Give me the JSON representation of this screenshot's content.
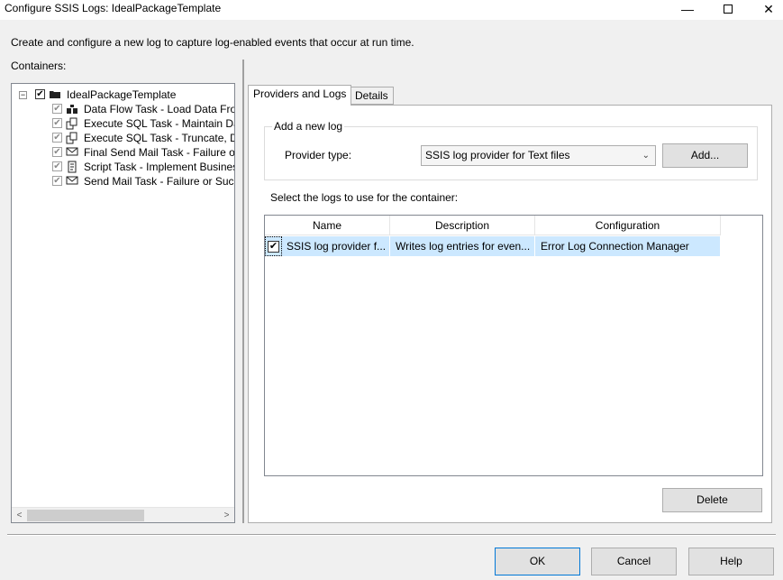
{
  "window": {
    "title": "Configure SSIS Logs: IdealPackageTemplate",
    "minimize_glyph": "—",
    "close_glyph": "✕"
  },
  "intro_text": "Create and configure a new log to capture log-enabled events that occur at run time.",
  "containers": {
    "label": "Containers:",
    "root": {
      "label": "IdealPackageTemplate",
      "expander": "−",
      "checked": "✔",
      "icon": "package-icon"
    },
    "children": [
      {
        "label": "Data Flow Task - Load Data From",
        "icon": "data-flow-icon",
        "checked": "✔"
      },
      {
        "label": "Execute SQL Task - Maintain Da",
        "icon": "sql-task-icon",
        "checked": "✔"
      },
      {
        "label": "Execute SQL Task - Truncate, De",
        "icon": "sql-task-icon",
        "checked": "✔"
      },
      {
        "label": "Final Send Mail Task - Failure or",
        "icon": "mail-icon",
        "checked": "✔"
      },
      {
        "label": "Script Task - Implement Busines",
        "icon": "script-icon",
        "checked": "✔"
      },
      {
        "label": "Send Mail Task - Failure or Succ",
        "icon": "mail-icon",
        "checked": "✔"
      }
    ],
    "scroll_left": "<",
    "scroll_right": ">"
  },
  "tabs": [
    {
      "label": "Providers and Logs",
      "active": true
    },
    {
      "label": "Details",
      "active": false
    }
  ],
  "add_log": {
    "legend": "Add a new log",
    "provider_label": "Provider type:",
    "provider_value": "SSIS log provider for Text files",
    "add_button": "Add..."
  },
  "logs": {
    "label": "Select the logs to use for the container:",
    "columns": [
      "Name",
      "Description",
      "Configuration"
    ],
    "rows": [
      {
        "checked": "✔",
        "name": "SSIS log provider f...",
        "description": "Writes log entries for even...",
        "configuration": "Error Log Connection Manager"
      }
    ]
  },
  "delete_button": "Delete",
  "footer": {
    "ok": "OK",
    "cancel": "Cancel",
    "help": "Help"
  },
  "colors": {
    "selection": "#cce8ff",
    "default_button_border": "#0078d7"
  }
}
